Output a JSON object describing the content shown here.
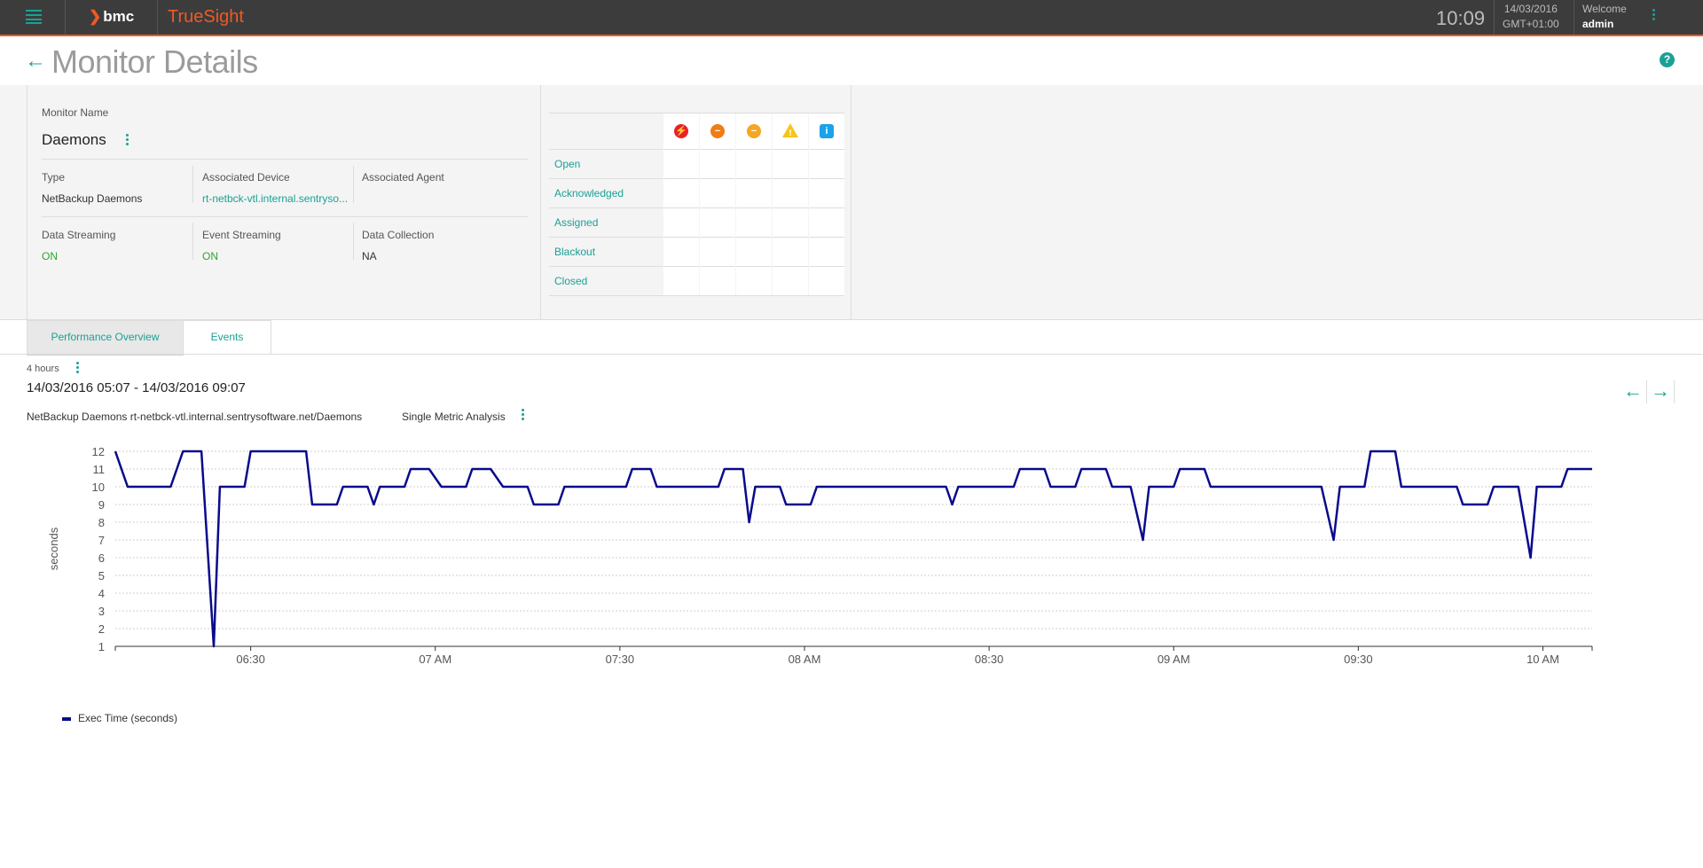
{
  "header": {
    "brand": "bmc",
    "product": "TrueSight",
    "time": "10:09",
    "date": "14/03/2016",
    "timezone": "GMT+01:00",
    "welcome": "Welcome",
    "user": "admin"
  },
  "page": {
    "title": "Monitor Details"
  },
  "monitor": {
    "name_label": "Monitor Name",
    "name": "Daemons",
    "fields": [
      {
        "label": "Type",
        "value": "NetBackup Daemons"
      },
      {
        "label": "Associated Device",
        "value": "rt-netbck-vtl.internal.sentryso..."
      },
      {
        "label": "Associated Agent",
        "value": ""
      },
      {
        "label": "Data Streaming",
        "value": "ON"
      },
      {
        "label": "Event Streaming",
        "value": "ON"
      },
      {
        "label": "Data Collection",
        "value": "NA"
      }
    ]
  },
  "events": {
    "severity_icons": [
      {
        "icon": "critical-icon",
        "color": "#e8222a",
        "glyph": "⚡"
      },
      {
        "icon": "major-icon",
        "color": "#f07c14",
        "glyph": "−"
      },
      {
        "icon": "minor-icon",
        "color": "#f5a623",
        "glyph": "−"
      },
      {
        "icon": "warning-icon",
        "color": "#f7c51b",
        "glyph": "!"
      },
      {
        "icon": "info-icon",
        "color": "#1aa3e8",
        "glyph": "i"
      }
    ],
    "rows": [
      "Open",
      "Acknowledged",
      "Assigned",
      "Blackout",
      "Closed"
    ]
  },
  "tabs": [
    "Performance Overview",
    "Events"
  ],
  "performance": {
    "range": "4 hours",
    "dates": "14/03/2016 05:07 - 14/03/2016 09:07",
    "monitor_path": "NetBackup Daemons rt-netbck-vtl.internal.sentrysoftware.net/Daemons",
    "analysis": "Single Metric Analysis"
  },
  "chart_data": {
    "type": "line",
    "ylabel": "seconds",
    "ylim": [
      1,
      12
    ],
    "yticks": [
      1,
      2,
      3,
      4,
      5,
      6,
      7,
      8,
      9,
      10,
      11,
      12
    ],
    "xlim": [
      "06:08",
      "10:08"
    ],
    "xticks": [
      {
        "t": "06:30",
        "label": "06:30"
      },
      {
        "t": "07:00",
        "label": "07 AM"
      },
      {
        "t": "07:30",
        "label": "07:30"
      },
      {
        "t": "08:00",
        "label": "08 AM"
      },
      {
        "t": "08:30",
        "label": "08:30"
      },
      {
        "t": "09:00",
        "label": "09 AM"
      },
      {
        "t": "09:30",
        "label": "09:30"
      },
      {
        "t": "10:00",
        "label": "10 AM"
      }
    ],
    "grid": true,
    "series": [
      {
        "name": "Exec Time (seconds)",
        "color": "#0a0a8c",
        "points": [
          [
            "06:08",
            12
          ],
          [
            "06:10",
            10
          ],
          [
            "06:17",
            10
          ],
          [
            "06:19",
            12
          ],
          [
            "06:22",
            12
          ],
          [
            "06:24",
            1
          ],
          [
            "06:25",
            10
          ],
          [
            "06:29",
            10
          ],
          [
            "06:30",
            12
          ],
          [
            "06:39",
            12
          ],
          [
            "06:40",
            9
          ],
          [
            "06:44",
            9
          ],
          [
            "06:45",
            10
          ],
          [
            "06:49",
            10
          ],
          [
            "06:50",
            9
          ],
          [
            "06:51",
            10
          ],
          [
            "06:55",
            10
          ],
          [
            "06:56",
            11
          ],
          [
            "06:59",
            11
          ],
          [
            "07:01",
            10
          ],
          [
            "07:05",
            10
          ],
          [
            "07:06",
            11
          ],
          [
            "07:09",
            11
          ],
          [
            "07:11",
            10
          ],
          [
            "07:15",
            10
          ],
          [
            "07:16",
            9
          ],
          [
            "07:20",
            9
          ],
          [
            "07:21",
            10
          ],
          [
            "07:31",
            10
          ],
          [
            "07:32",
            11
          ],
          [
            "07:35",
            11
          ],
          [
            "07:36",
            10
          ],
          [
            "07:46",
            10
          ],
          [
            "07:47",
            11
          ],
          [
            "07:50",
            11
          ],
          [
            "07:51",
            8
          ],
          [
            "07:52",
            10
          ],
          [
            "07:56",
            10
          ],
          [
            "07:57",
            9
          ],
          [
            "08:01",
            9
          ],
          [
            "08:02",
            10
          ],
          [
            "08:23",
            10
          ],
          [
            "08:24",
            9
          ],
          [
            "08:25",
            10
          ],
          [
            "08:34",
            10
          ],
          [
            "08:35",
            11
          ],
          [
            "08:39",
            11
          ],
          [
            "08:40",
            10
          ],
          [
            "08:44",
            10
          ],
          [
            "08:45",
            11
          ],
          [
            "08:49",
            11
          ],
          [
            "08:50",
            10
          ],
          [
            "08:53",
            10
          ],
          [
            "08:55",
            7
          ],
          [
            "08:56",
            10
          ],
          [
            "09:00",
            10
          ],
          [
            "09:01",
            11
          ],
          [
            "09:05",
            11
          ],
          [
            "09:06",
            10
          ],
          [
            "09:24",
            10
          ],
          [
            "09:26",
            7
          ],
          [
            "09:27",
            10
          ],
          [
            "09:31",
            10
          ],
          [
            "09:32",
            12
          ],
          [
            "09:36",
            12
          ],
          [
            "09:37",
            10
          ],
          [
            "09:46",
            10
          ],
          [
            "09:47",
            9
          ],
          [
            "09:51",
            9
          ],
          [
            "09:52",
            10
          ],
          [
            "09:56",
            10
          ],
          [
            "09:58",
            6
          ],
          [
            "09:59",
            10
          ],
          [
            "10:03",
            10
          ],
          [
            "10:04",
            11
          ],
          [
            "10:08",
            11
          ]
        ]
      }
    ]
  }
}
